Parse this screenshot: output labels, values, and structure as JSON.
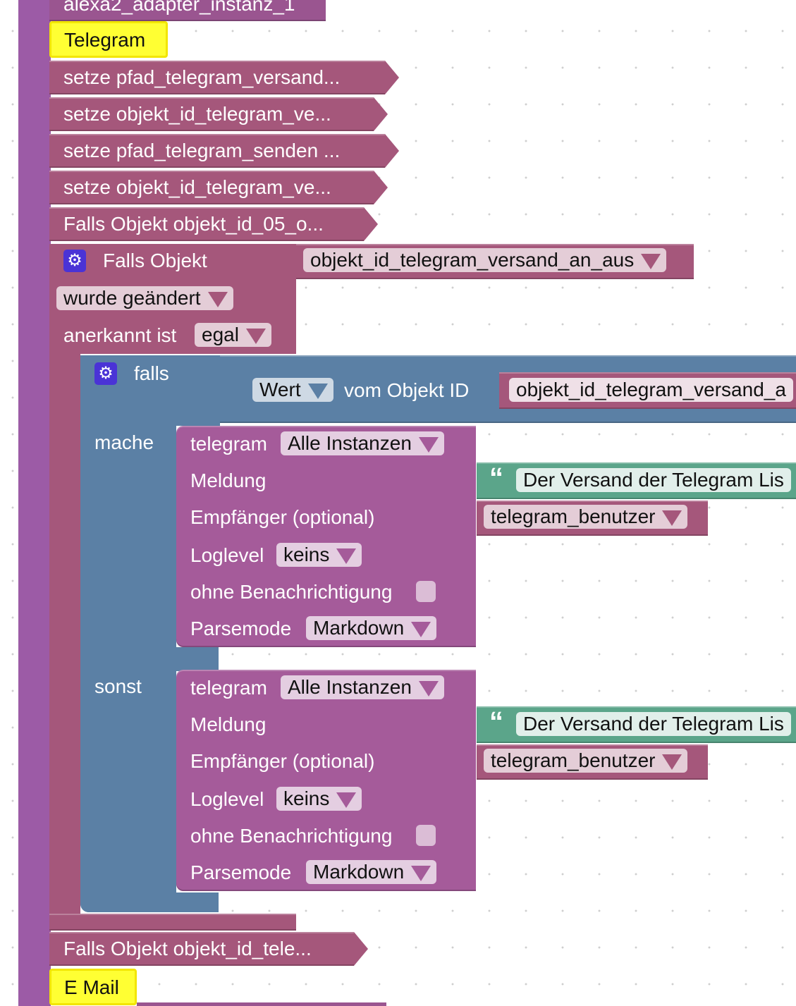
{
  "blocks": {
    "top_partial": "alexa2_adapter_instanz_1",
    "comment_telegram": "Telegram",
    "set_rows": [
      "setze pfad_telegram_versand...",
      "setze objekt_id_telegram_ve...",
      "setze pfad_telegram_senden ...",
      "setze objekt_id_telegram_ve...",
      "Falls Objekt objekt_id_05_o..."
    ],
    "falls_objekt": {
      "label": "Falls Objekt",
      "object_var": "objekt_id_telegram_versand_an_aus",
      "changed_label": "wurde geändert",
      "ack_label": "anerkannt ist",
      "ack_value": "egal"
    },
    "if_block": {
      "label": "falls",
      "value_dd": "Wert",
      "from_object": "vom Objekt ID",
      "object_var": "objekt_id_telegram_versand_a",
      "do_label": "mache",
      "else_label": "sonst"
    },
    "telegram_blocks": [
      {
        "title": "telegram",
        "instances": "Alle Instanzen",
        "message_label": "Meldung",
        "message_text": "Der Versand der Telegram Lis",
        "recipient_label": "Empfänger (optional)",
        "recipient_var": "telegram_benutzer",
        "loglevel_label": "Loglevel",
        "loglevel_value": "keins",
        "silent_label": "ohne Benachrichtigung",
        "parse_label": "Parsemode",
        "parse_value": "Markdown"
      },
      {
        "title": "telegram",
        "instances": "Alle Instanzen",
        "message_label": "Meldung",
        "message_text": "Der Versand der Telegram Lis",
        "recipient_label": "Empfänger (optional)",
        "recipient_var": "telegram_benutzer",
        "loglevel_label": "Loglevel",
        "loglevel_value": "keins",
        "silent_label": "ohne Benachrichtigung",
        "parse_label": "Parsemode",
        "parse_value": "Markdown"
      }
    ],
    "bottom_row": "Falls Objekt objekt_id_tele...",
    "comment_email": "E Mail",
    "quote_glyph": "“",
    "gear_glyph": "⚙"
  }
}
